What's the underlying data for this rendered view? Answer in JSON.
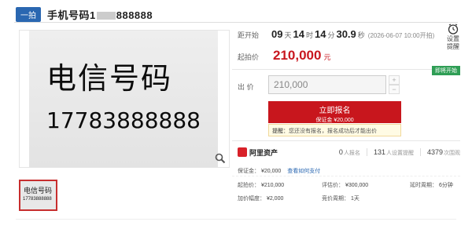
{
  "header": {
    "badge": "一拍",
    "title_prefix": "手机号码1",
    "title_suffix": "888888"
  },
  "gallery": {
    "photo_line1": "电信号码",
    "photo_line2": "17783888888",
    "thumb_line1": "电信号码",
    "thumb_line2": "17783888888"
  },
  "countdown": {
    "label": "距开始",
    "days": "09",
    "days_unit": "天",
    "hours": "14",
    "hours_unit": "时",
    "minutes": "14",
    "minutes_unit": "分",
    "seconds": "30.9",
    "seconds_unit": "秒",
    "start_date": "(2026-06-07 10:00开拍)"
  },
  "remind": {
    "line1": "设置",
    "line2": "提醒"
  },
  "start_price": {
    "label": "起拍价",
    "value": "210,000",
    "unit": "元"
  },
  "status_tag": "即将开始",
  "bid": {
    "label": "出  价",
    "value": "210,000",
    "plus": "+",
    "minus": "−"
  },
  "signup": {
    "label": "立即报名",
    "deposit": "保证金 ¥20,000"
  },
  "tip": {
    "prefix": "提醒：",
    "text": "您还没有报名，报名成功后才能出价"
  },
  "platform": {
    "name": "阿里资产",
    "signups": "0",
    "signups_label": "人报名",
    "reminders": "131",
    "reminders_label": "人设置提醒",
    "views": "4379",
    "views_label": "次围观"
  },
  "details": {
    "deposit_label": "保证金：",
    "deposit_value": "¥20,000",
    "deposit_link": "查看如何支付",
    "start_label": "起拍价：",
    "start_value": "¥210,000",
    "eval_label": "评估价：",
    "eval_value": "¥300,000",
    "delay_label": "延时周期：",
    "delay_value": "6分钟",
    "step_label": "加价幅度：",
    "step_value": "¥2,000",
    "period_label": "竞价周期：",
    "period_value": "1天"
  }
}
